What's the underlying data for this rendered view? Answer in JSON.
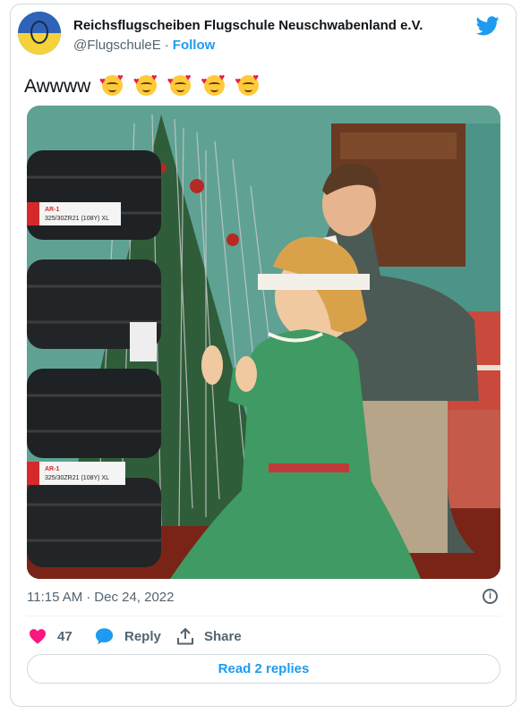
{
  "author": {
    "name": "Reichsflugscheiben Flugschule Neuschwabenland e.V.",
    "handle": "@FlugschuleE",
    "follow_label": "Follow"
  },
  "tweet": {
    "text": "Awwww",
    "emojis": [
      "smiling-face-with-hearts",
      "smiling-face-with-hearts",
      "smiling-face-with-hearts",
      "smiling-face-with-hearts",
      "smiling-face-with-hearts"
    ]
  },
  "photo": {
    "tire_labels": [
      "325/30ZR21 (108Y) XL",
      "325/30ZR21 (108Y) XL"
    ],
    "tire_brand": "AR-1"
  },
  "meta": {
    "time": "11:15 AM",
    "date": "Dec 24, 2022",
    "separator": "·"
  },
  "actions": {
    "like_count": "47",
    "reply_label": "Reply",
    "share_label": "Share"
  },
  "read_replies_label": "Read 2 replies",
  "colors": {
    "accent": "#1d9bf0",
    "like": "#f91880",
    "muted": "#536471"
  }
}
